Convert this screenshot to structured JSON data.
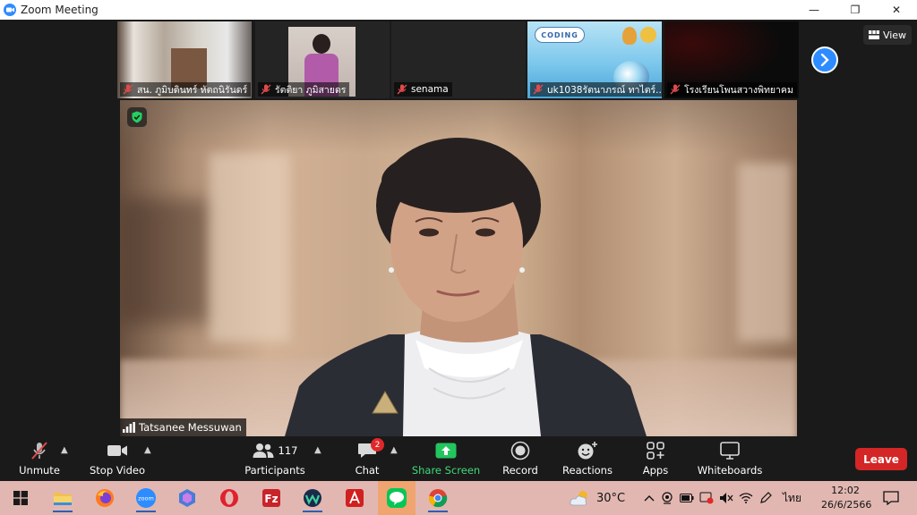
{
  "window": {
    "title": "Zoom Meeting",
    "controls": {
      "minimize": "—",
      "maximize": "❐",
      "close": "✕"
    }
  },
  "gallery": {
    "view_label": "View",
    "thumbnails": [
      {
        "name": "สน. ภูมิบดินทร์  หัตถนิรันดร์",
        "muted": true
      },
      {
        "name": "รัตติยา ภูมิสายดร",
        "muted": true
      },
      {
        "name": "senama",
        "muted": true
      },
      {
        "name": "uk1038รัตนาภรณ์ ทาไตร์...",
        "muted": true,
        "slide_text": "CODING"
      },
      {
        "name": "โรงเรียนโพนสวางพิทยาคม",
        "muted": true
      }
    ]
  },
  "active_speaker": {
    "name": "Tatsanee Messuwan"
  },
  "toolbar": {
    "unmute": "Unmute",
    "stop_video": "Stop Video",
    "participants": "Participants",
    "participants_count": "117",
    "chat": "Chat",
    "chat_badge": "2",
    "share_screen": "Share Screen",
    "record": "Record",
    "reactions": "Reactions",
    "apps": "Apps",
    "whiteboards": "Whiteboards",
    "leave": "Leave"
  },
  "taskbar": {
    "apps": [
      "windows-start",
      "file-explorer",
      "firefox",
      "zoom",
      "copilot",
      "opera",
      "filezilla",
      "webex",
      "adobe-reader",
      "line",
      "chrome"
    ],
    "zoom_app_text": "zoom",
    "weather": "30°C",
    "language": "ไทย",
    "time": "12:02",
    "date": "26/6/2566"
  },
  "colors": {
    "zoom_blue": "#2d8cff",
    "share_green": "#40d97a",
    "leave_red": "#d42626",
    "taskbar_bg": "#e2b7b1"
  }
}
